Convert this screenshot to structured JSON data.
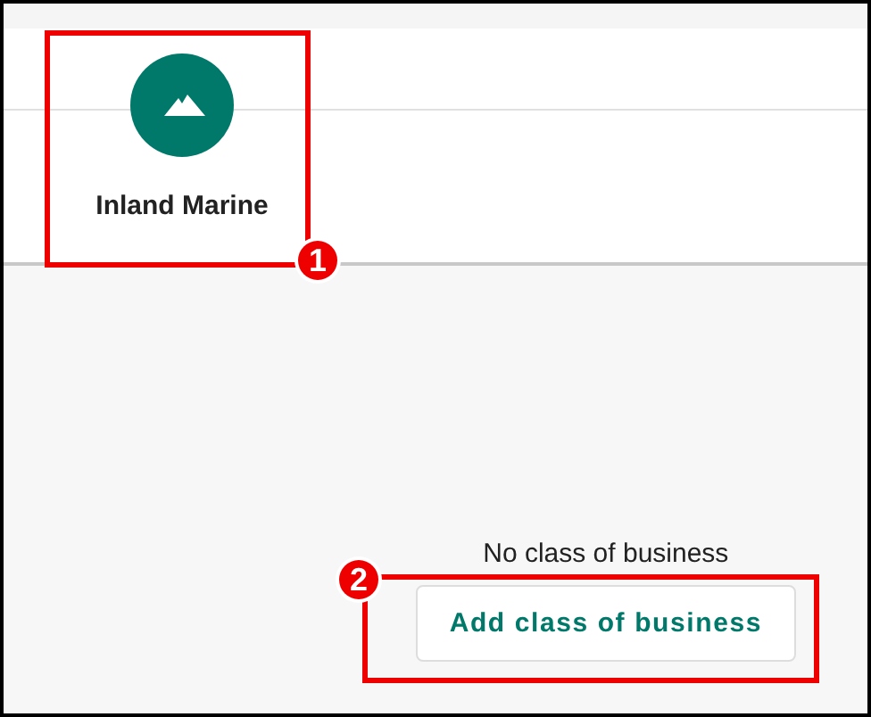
{
  "category_tab": {
    "label": "Inland Marine"
  },
  "empty_state": {
    "message": "No class of business",
    "button": "Add class of business"
  },
  "callouts": [
    {
      "number": "1"
    },
    {
      "number": "2"
    }
  ]
}
